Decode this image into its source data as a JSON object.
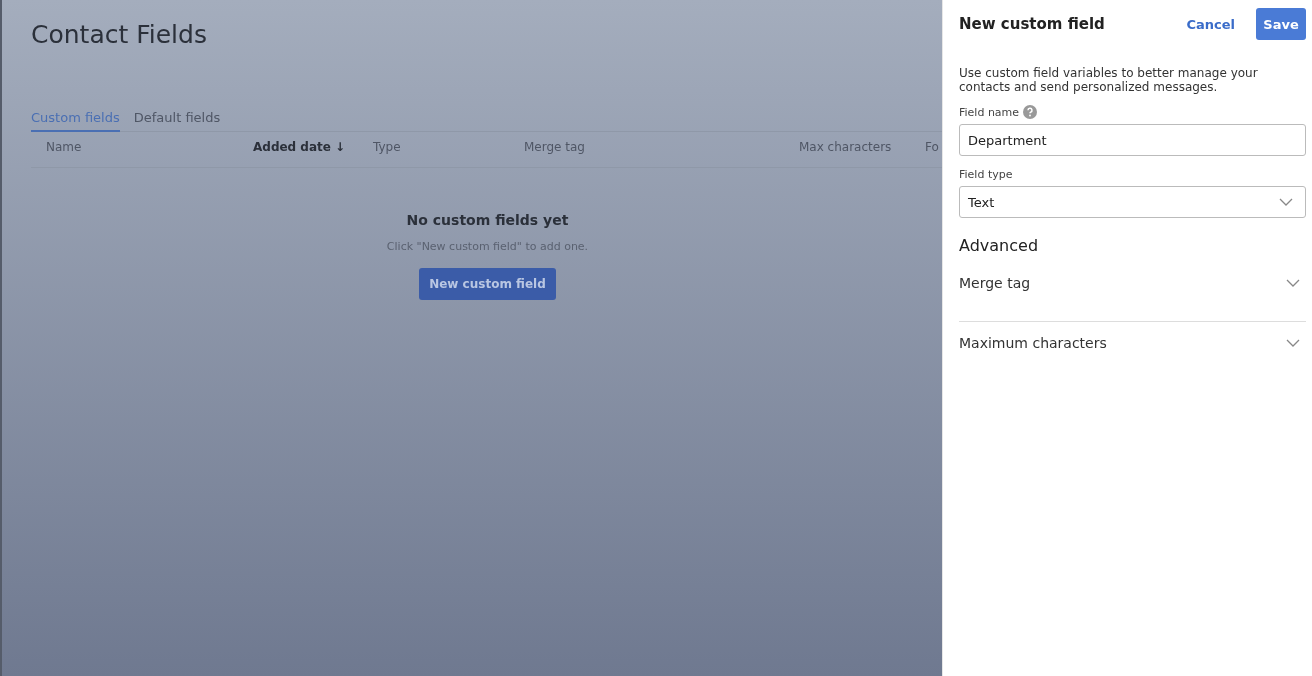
{
  "page": {
    "title": "Contact Fields",
    "tabs": [
      {
        "label": "Custom fields",
        "selected": true
      },
      {
        "label": "Default fields",
        "selected": false
      }
    ],
    "table": {
      "columns": [
        {
          "label": "Name",
          "sorted": false
        },
        {
          "label": "Added date",
          "sorted": true,
          "sort_arrow": "↓"
        },
        {
          "label": "Type",
          "sorted": false
        },
        {
          "label": "Merge tag",
          "sorted": false
        },
        {
          "label": "Max characters",
          "sorted": false
        },
        {
          "label": "Fo",
          "sorted": false
        }
      ]
    },
    "empty_state": {
      "title": "No custom fields yet",
      "message": "Click \"New custom field\" to add one.",
      "button": "New custom field"
    }
  },
  "panel": {
    "title": "New custom field",
    "cancel": "Cancel",
    "save": "Save",
    "description": "Use custom field variables to better manage your contacts and send personalized messages.",
    "fields": [
      {
        "kind": "text",
        "label": "Field name",
        "help_icon": true,
        "value": "Department"
      },
      {
        "kind": "select",
        "label": "Field type",
        "help_icon": false,
        "value": "Text"
      }
    ],
    "advanced": {
      "title": "Advanced",
      "sections": [
        {
          "label": "Merge tag",
          "expanded": false
        },
        {
          "label": "Maximum characters",
          "expanded": false
        }
      ]
    }
  }
}
